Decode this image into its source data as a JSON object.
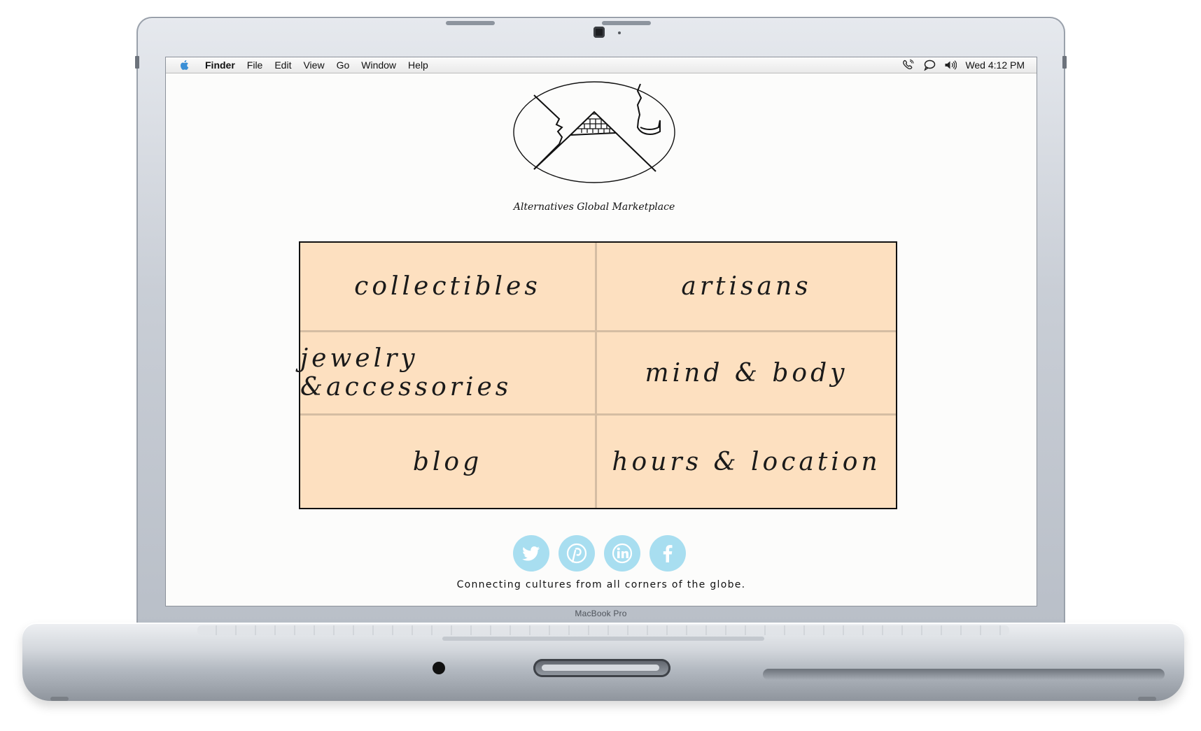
{
  "device": {
    "brand_label": "MacBook Pro"
  },
  "menubar": {
    "app_name": "Finder",
    "items": [
      "File",
      "Edit",
      "View",
      "Go",
      "Window",
      "Help"
    ],
    "status_icons": [
      "phone-icon",
      "chat-bubble-icon",
      "volume-icon"
    ],
    "clock": "Wed 4:12 PM"
  },
  "page": {
    "logo_caption": "Alternatives Global Marketplace",
    "nav": [
      {
        "label": "collectibles"
      },
      {
        "label": "artisans"
      },
      {
        "label": "jewelry &accessories"
      },
      {
        "label": "mind & body"
      },
      {
        "label": "blog"
      },
      {
        "label": "hours & location"
      }
    ],
    "social": [
      {
        "icon": "twitter-icon"
      },
      {
        "icon": "pinterest-icon"
      },
      {
        "icon": "linkedin-icon"
      },
      {
        "icon": "facebook-icon"
      }
    ],
    "tagline": "Connecting cultures from all corners of the globe."
  },
  "colors": {
    "nav_background": "#fde0c0",
    "social_circle": "#a8def0",
    "apple_logo": "#3a8fd6"
  }
}
